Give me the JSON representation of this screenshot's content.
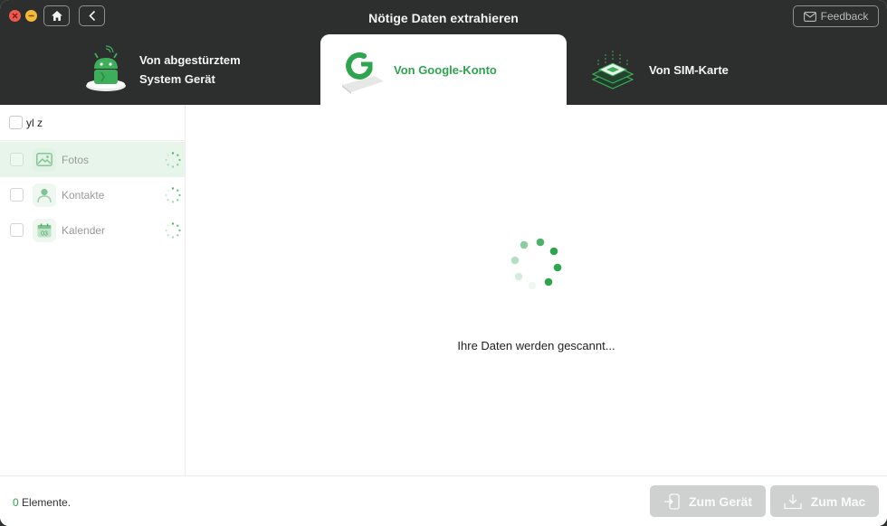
{
  "window": {
    "title": "Nötige Daten extrahieren",
    "feedback_label": "Feedback"
  },
  "icons": {
    "close": "close-icon",
    "minimize": "minimize-icon",
    "home": "home-icon",
    "back": "chevron-left-icon",
    "feedback": "mail-icon"
  },
  "tabs": [
    {
      "label": "Von abgestürztem\nSystem Gerät",
      "icon": "android-robot-icon",
      "active": false
    },
    {
      "label": "Von Google-Konto",
      "icon": "google-account-icon",
      "active": true
    },
    {
      "label": "Von SIM-Karte",
      "icon": "sim-card-icon",
      "active": false
    }
  ],
  "sidebar": {
    "header_label": "yl z",
    "items": [
      {
        "label": "Fotos",
        "icon": "photo-icon",
        "selected": true
      },
      {
        "label": "Kontakte",
        "icon": "contact-icon",
        "selected": false
      },
      {
        "label": "Kalender",
        "icon": "calendar-icon",
        "selected": false,
        "icon_text": "03"
      }
    ]
  },
  "main": {
    "status_text": "Ihre Daten werden gescannt..."
  },
  "footer": {
    "count": "0",
    "count_suffix": " Elemente.",
    "to_device_label": "Zum Gerät",
    "to_mac_label": "Zum Mac"
  },
  "colors": {
    "accent": "#2ea44f",
    "topbar": "#2d2e2e",
    "selected_row": "#e8f5eb",
    "disabled_button": "#cfd0d0"
  }
}
